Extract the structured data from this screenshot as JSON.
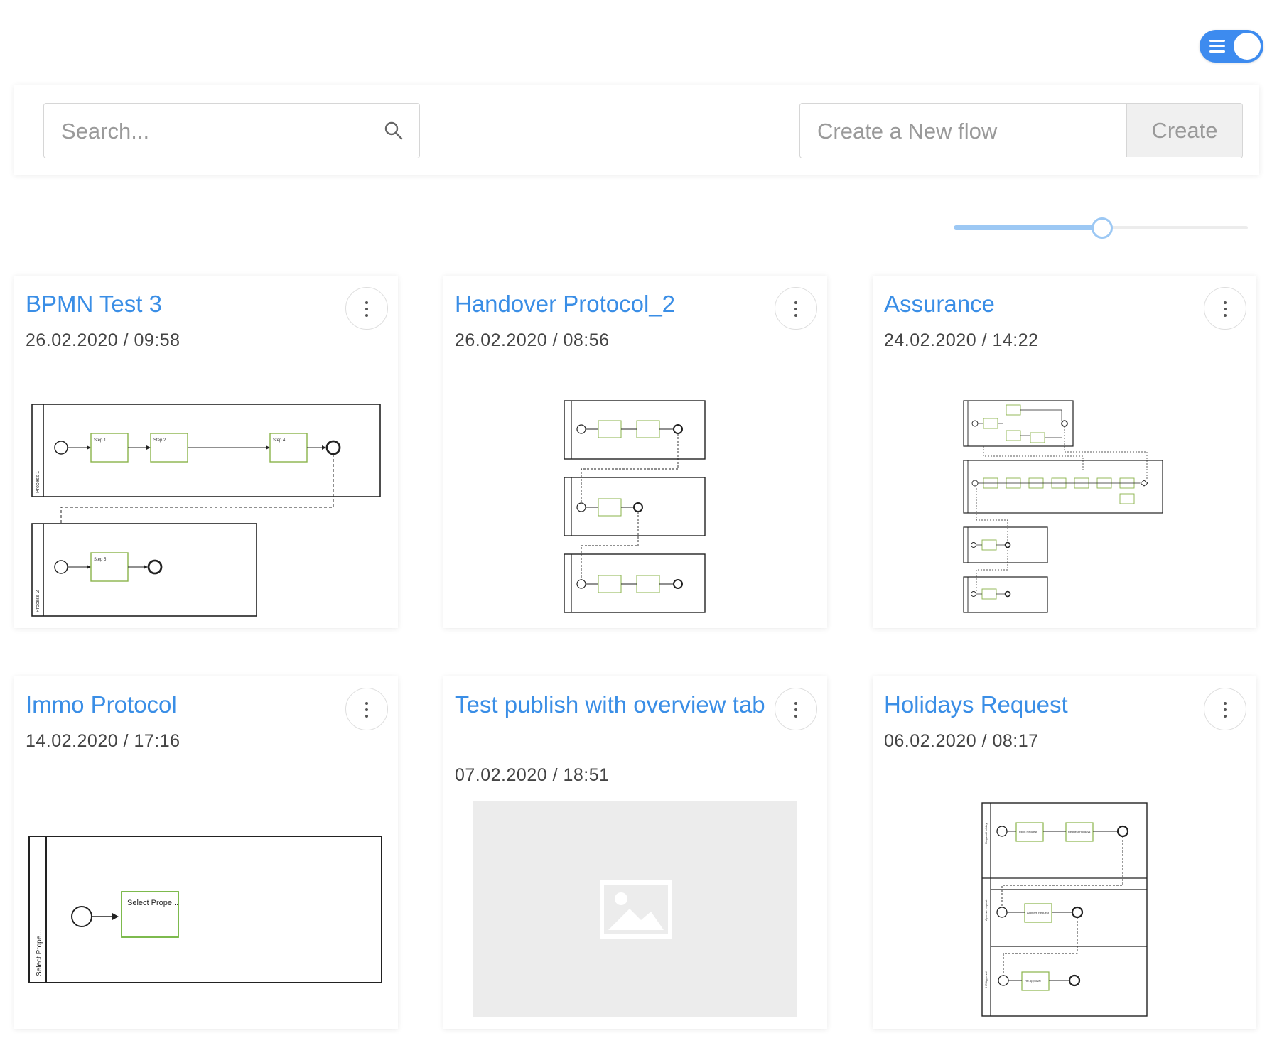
{
  "header": {
    "toggle_label": "List view toggle"
  },
  "toolbar": {
    "search_placeholder": "Search...",
    "create_placeholder": "Create a New flow",
    "create_label": "Create"
  },
  "zoom_slider": {
    "value_fraction": 0.5
  },
  "cards": [
    {
      "title": "BPMN Test 3",
      "date": "26.02.2020 / 09:58"
    },
    {
      "title": "Handover Protocol_2",
      "date": "26.02.2020 / 08:56"
    },
    {
      "title": "Assurance",
      "date": "24.02.2020 / 14:22"
    },
    {
      "title": "Immo Protocol",
      "date": "14.02.2020 / 17:16"
    },
    {
      "title": "Test publish with overview tab",
      "date": "07.02.2020 / 18:51"
    },
    {
      "title": "Holidays Request",
      "date": "06.02.2020 / 08:17"
    }
  ],
  "previews": {
    "bpmn_test_3": {
      "pool_1": "Process 1",
      "pool_2": "Process 2",
      "tasks": [
        "Step 1",
        "Step 2",
        "Step 4",
        "Step 5"
      ]
    },
    "immo_protocol": {
      "pool": "Select Prope...",
      "task": "Select Prope..."
    },
    "holidays_request": {
      "lane_1": "Request Holiday",
      "lane_2": "Approve request",
      "lane_3": "HR Approval",
      "tasks": [
        "Fill in Request",
        "Request Holidays",
        "Approve Request",
        "HR Approval"
      ]
    }
  }
}
